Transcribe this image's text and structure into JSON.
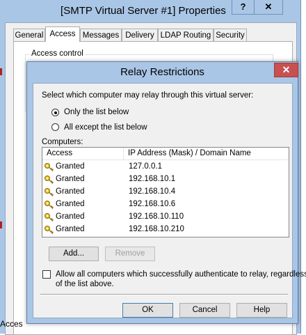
{
  "properties_window": {
    "title": "[SMTP Virtual Server #1] Properties",
    "help_button": "?",
    "close_button": "✕",
    "tabs": [
      {
        "label": "General",
        "active": false
      },
      {
        "label": "Access",
        "active": true
      },
      {
        "label": "Messages",
        "active": false
      },
      {
        "label": "Delivery",
        "active": false
      },
      {
        "label": "LDAP Routing",
        "active": false
      },
      {
        "label": "Security",
        "active": false
      }
    ],
    "group_label": "Access control",
    "bottom_fragment": "Acces"
  },
  "dialog": {
    "title": "Relay Restrictions",
    "close_button": "✕",
    "instruction": "Select which computer may relay through this virtual server:",
    "radio_only": "Only the list below",
    "radio_all_except": "All except the list below",
    "radio_selected": "only",
    "computers_label": "Computers:",
    "columns": {
      "access": "Access",
      "ip": "IP Address (Mask) / Domain Name"
    },
    "rows": [
      {
        "access": "Granted",
        "ip": "127.0.0.1",
        "icon": "key-icon"
      },
      {
        "access": "Granted",
        "ip": "192.168.10.1",
        "icon": "key-icon"
      },
      {
        "access": "Granted",
        "ip": "192.168.10.4",
        "icon": "key-icon"
      },
      {
        "access": "Granted",
        "ip": "192.168.10.6",
        "icon": "key-icon"
      },
      {
        "access": "Granted",
        "ip": "192.168.10.110",
        "icon": "key-icon"
      },
      {
        "access": "Granted",
        "ip": "192.168.10.210",
        "icon": "key-icon"
      }
    ],
    "add_button": "Add...",
    "remove_button": "Remove",
    "checkbox_line1": "Allow all computers which successfully authenticate to relay, regardless",
    "checkbox_line2": "of the list above.",
    "checkbox_checked": false,
    "ok_button": "OK",
    "cancel_button": "Cancel",
    "help_button": "Help"
  },
  "colors": {
    "title_bar": "#a9c6e6",
    "close_red": "#c75050",
    "key_gold": "#d8b21c"
  }
}
